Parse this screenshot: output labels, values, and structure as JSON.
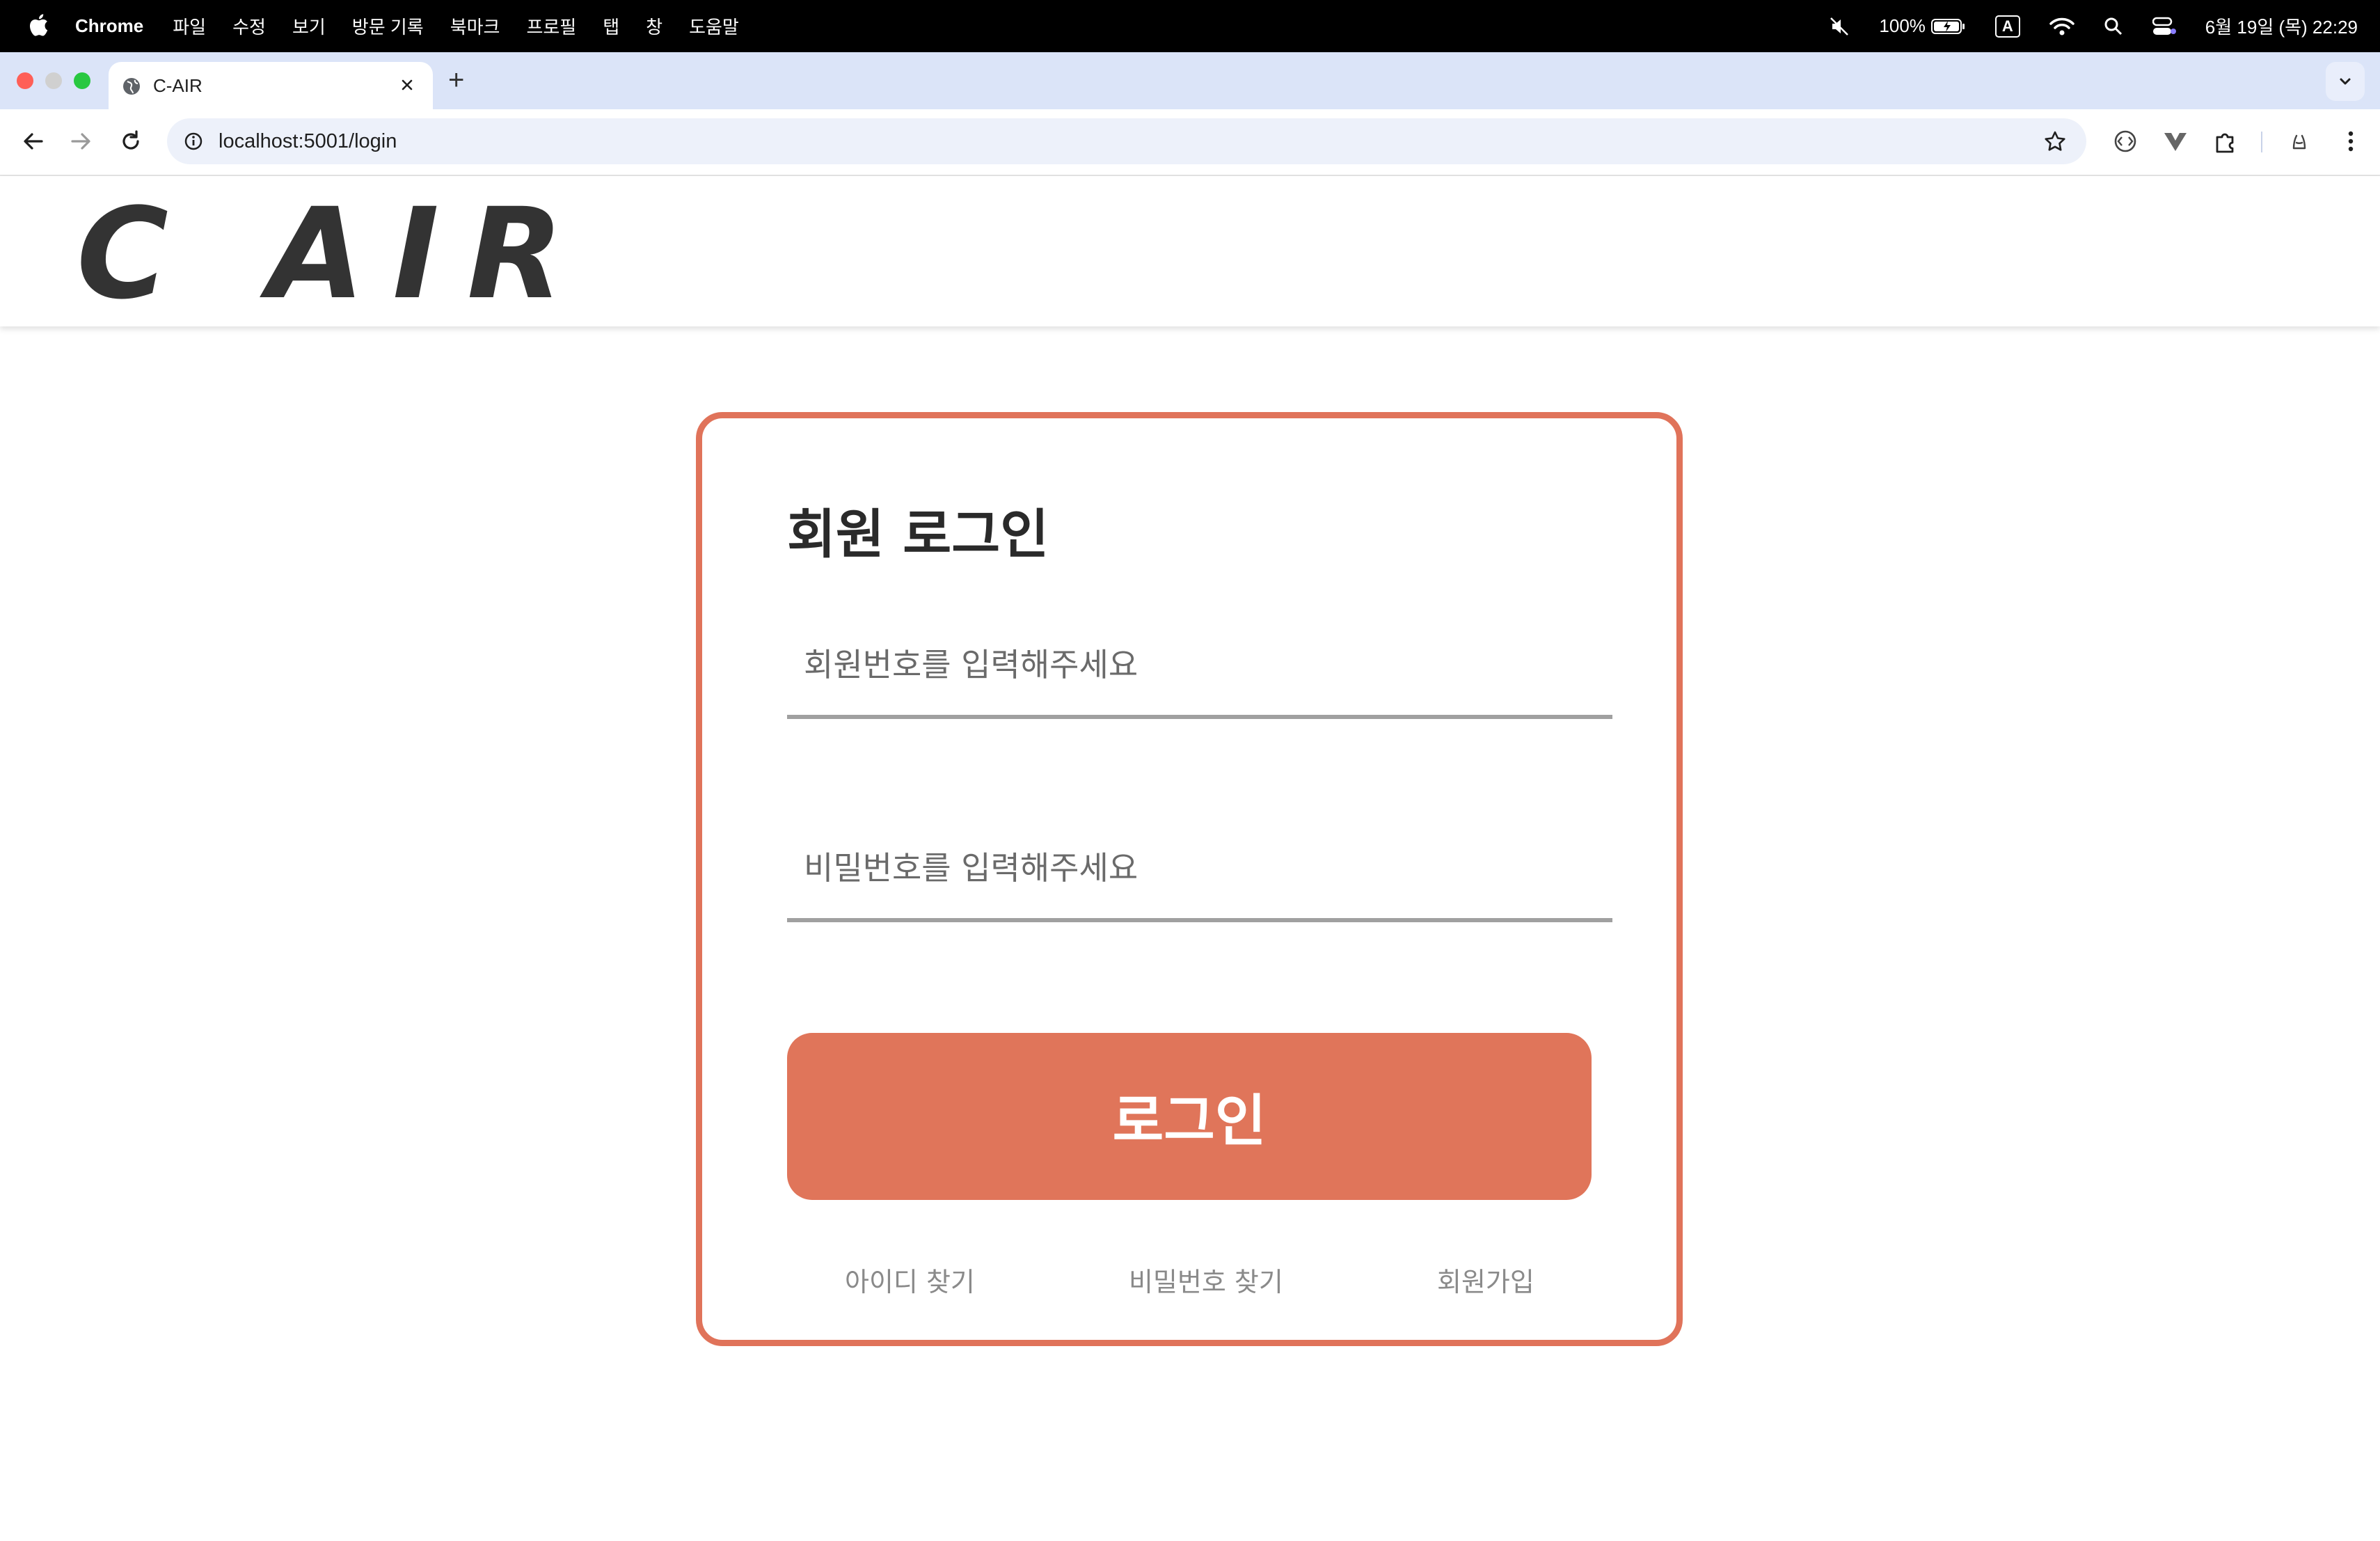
{
  "menubar": {
    "app_name": "Chrome",
    "menus": [
      "파일",
      "수정",
      "보기",
      "방문 기록",
      "북마크",
      "프로필",
      "탭",
      "창",
      "도움말"
    ],
    "battery": "100%",
    "input_source": "A",
    "datetime": "6월 19일 (목) 22:29"
  },
  "browser": {
    "tab_title": "C-AIR",
    "url": "localhost:5001/login"
  },
  "site": {
    "logo_text": "C AIR"
  },
  "login": {
    "title": "회원 로그인",
    "member_id_placeholder": "회원번호를 입력해주세요",
    "password_placeholder": "비밀번호를 입력해주세요",
    "login_button": "로그인",
    "links": {
      "find_id": "아이디 찾기",
      "find_password": "비밀번호 찾기",
      "signup": "회원가입"
    }
  },
  "colors": {
    "accent": "#e0735a",
    "button": "#e0755a",
    "underline": "#a0a0a0"
  }
}
